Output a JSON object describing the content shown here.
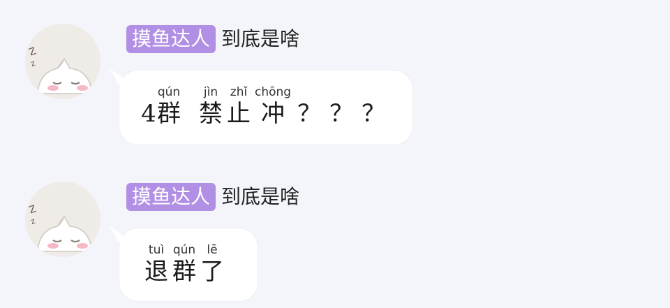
{
  "messages": [
    {
      "sender_badge": "摸鱼达人",
      "sender_name": "到底是啥",
      "avatar_icon": "sleepy-cat-icon",
      "bubble": [
        {
          "py": "",
          "hz": "4"
        },
        {
          "py": "qún",
          "hz": "群"
        },
        {
          "py": "",
          "hz": " "
        },
        {
          "py": "jìn",
          "hz": "禁"
        },
        {
          "py": "zhǐ",
          "hz": "止"
        },
        {
          "py": "chōng",
          "hz": "冲"
        },
        {
          "py": "",
          "hz": "？"
        },
        {
          "py": "",
          "hz": "？"
        },
        {
          "py": "",
          "hz": "？"
        }
      ]
    },
    {
      "sender_badge": "摸鱼达人",
      "sender_name": "到底是啥",
      "avatar_icon": "sleepy-cat-icon",
      "bubble": [
        {
          "py": "tuì",
          "hz": "退"
        },
        {
          "py": "qún",
          "hz": "群"
        },
        {
          "py": "lē",
          "hz": "了"
        }
      ]
    }
  ],
  "colors": {
    "background": "#f3f5fa",
    "badge": "#b18fe4",
    "bubble": "#ffffff"
  }
}
